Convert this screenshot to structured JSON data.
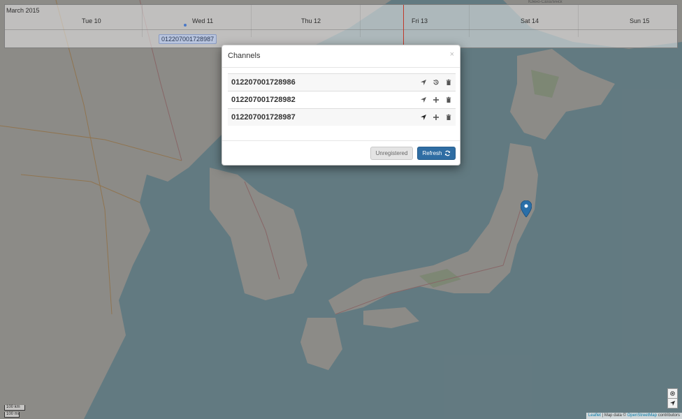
{
  "timeline": {
    "month": "March 2015",
    "days": [
      "Tue 10",
      "Wed 11",
      "Thu 12",
      "Fri 13",
      "Sat 14",
      "Sun 15"
    ],
    "event_label": "012207001728987"
  },
  "modal": {
    "title": "Channels",
    "close": "×",
    "channels": [
      {
        "id": "012207001728986",
        "second_icon": "history-icon"
      },
      {
        "id": "012207001728982",
        "second_icon": "plus-icon"
      },
      {
        "id": "012207001728987",
        "second_icon": "plus-icon"
      }
    ],
    "unregistered_label": "Unregistered",
    "refresh_label": "Refresh"
  },
  "map": {
    "scale_km": "100 km",
    "scale_mi": "100 mi",
    "attribution_leaflet": "Leaflet",
    "attribution_mid": " | Map data © ",
    "attribution_osm": "OpenStreetMap",
    "attribution_tail": " contributors",
    "top_label": "Южно-Сахалинск"
  },
  "colors": {
    "accent": "#2f6da3",
    "now_line": "#c0392b",
    "pin": "#2a6fa8"
  }
}
